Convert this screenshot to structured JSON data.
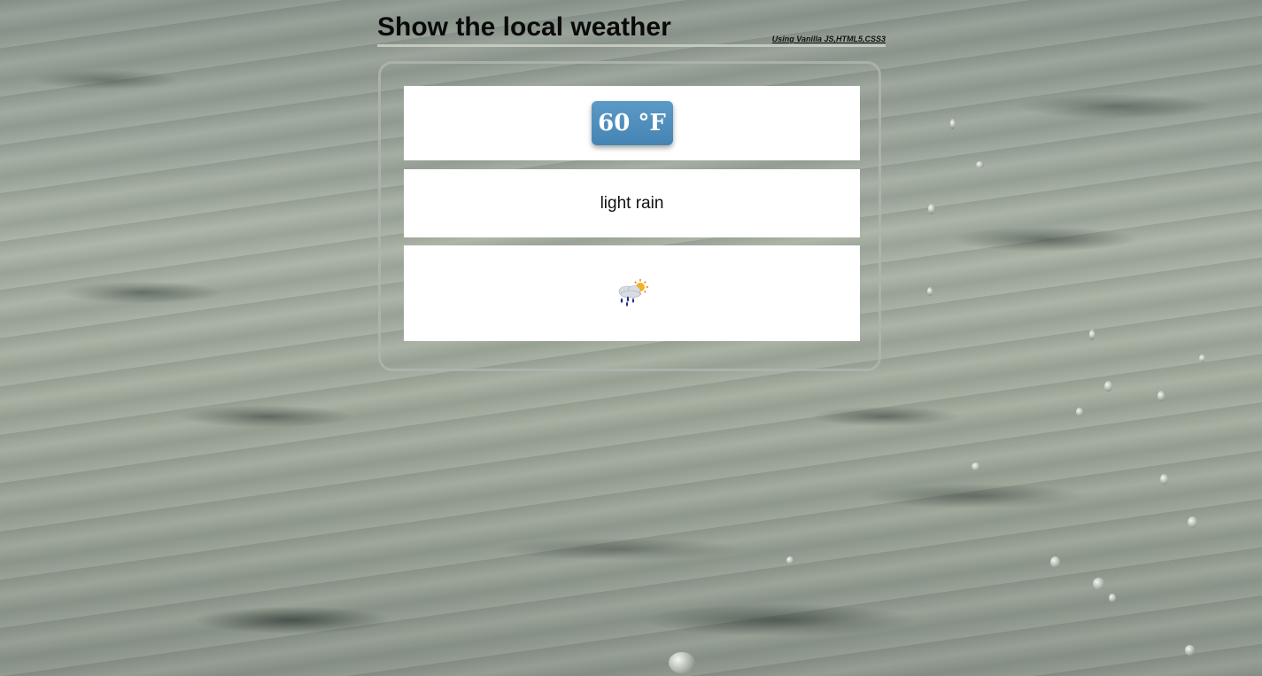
{
  "header": {
    "title": "Show the local weather",
    "subtitle": "Using Vanilla JS,HTML5,CSS3"
  },
  "weather": {
    "temperature": "60 °F",
    "description": "light rain",
    "icon": "light-rain-sun-icon"
  },
  "colors": {
    "badge": "#4f8fbf",
    "panel": "#ffffff",
    "title": "#0a0a0a"
  }
}
